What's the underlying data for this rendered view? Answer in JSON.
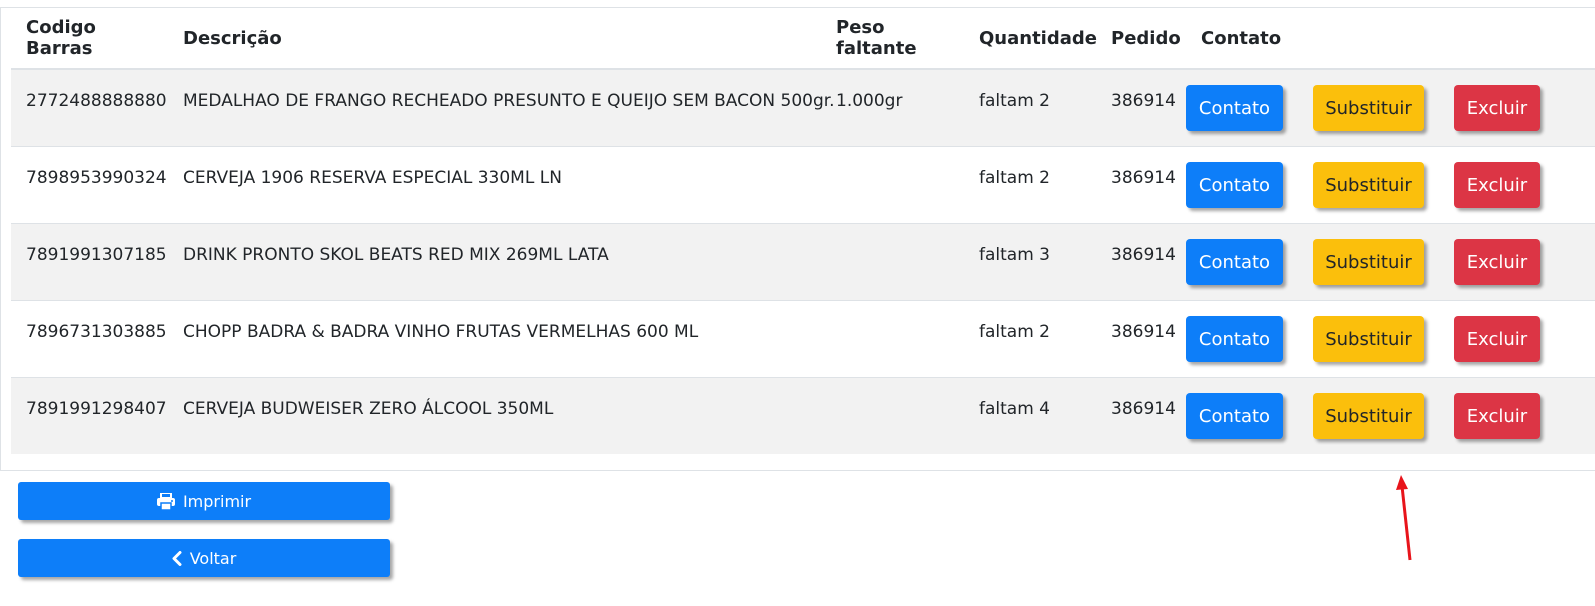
{
  "table": {
    "headers": {
      "barcode": "Codigo Barras",
      "description": "Descrição",
      "missing_weight": "Peso faltante",
      "quantity": "Quantidade",
      "order": "Pedido",
      "contact": "Contato"
    },
    "rows": [
      {
        "barcode": "2772488888880",
        "description": "MEDALHAO DE FRANGO RECHEADO PRESUNTO E QUEIJO SEM BACON 500gr.",
        "missing_weight": "1.000gr",
        "quantity": "faltam 2",
        "order": "386914"
      },
      {
        "barcode": "7898953990324",
        "description": "CERVEJA 1906 RESERVA ESPECIAL 330ML LN",
        "missing_weight": "",
        "quantity": "faltam 2",
        "order": "386914"
      },
      {
        "barcode": "7891991307185",
        "description": "DRINK PRONTO SKOL BEATS RED MIX 269ML LATA",
        "missing_weight": "",
        "quantity": "faltam 3",
        "order": "386914"
      },
      {
        "barcode": "7896731303885",
        "description": "CHOPP BADRA & BADRA VINHO FRUTAS VERMELHAS 600 ML",
        "missing_weight": "",
        "quantity": "faltam 2",
        "order": "386914"
      },
      {
        "barcode": "7891991298407",
        "description": "CERVEJA BUDWEISER ZERO ÁLCOOL 350ML",
        "missing_weight": "",
        "quantity": "faltam 4",
        "order": "386914"
      }
    ]
  },
  "row_actions": {
    "contact_label": "Contato",
    "substitute_label": "Substituir",
    "delete_label": "Excluir"
  },
  "footer": {
    "print_label": "Imprimir",
    "print_icon": "printer-icon",
    "back_label": "Voltar",
    "back_icon": "chevron-left-icon"
  },
  "colors": {
    "primary": "#0d7ef9",
    "warning": "#fbbf0c",
    "danger": "#dc3545",
    "annotation_arrow": "#e8141b"
  }
}
